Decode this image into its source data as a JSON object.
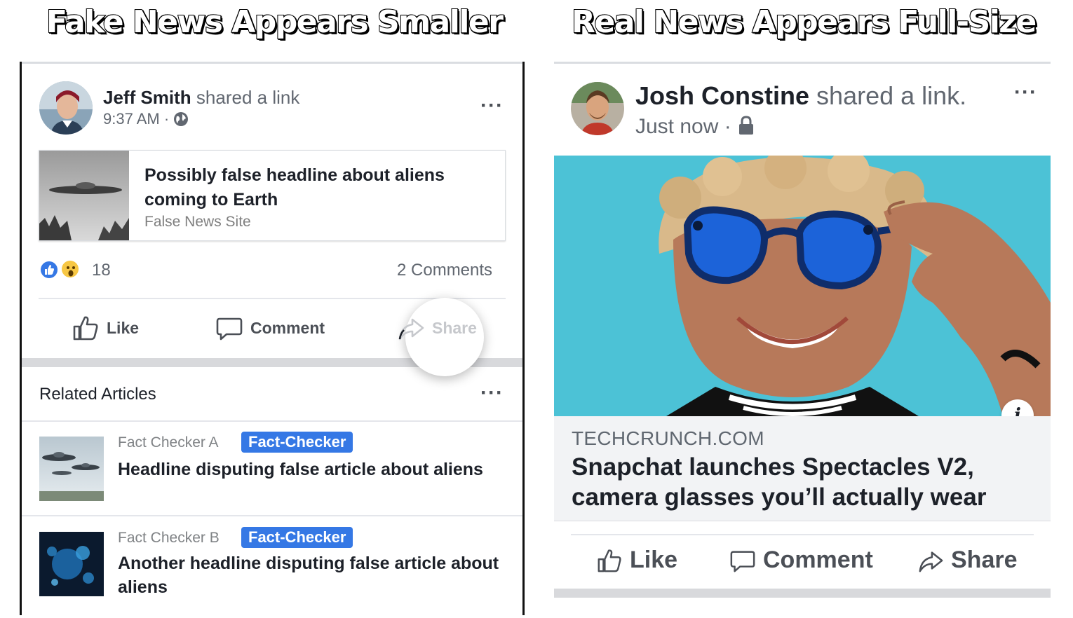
{
  "left_panel": {
    "banner": "Fake News Appears Smaller",
    "post": {
      "author": "Jeff Smith",
      "action": "shared a link",
      "time": "9:37 AM",
      "link": {
        "title": "Possibly false headline about aliens coming to Earth",
        "source": "False News Site"
      },
      "reaction_count": "18",
      "comments": "2 Comments",
      "like_label": "Like",
      "comment_label": "Comment",
      "share_label": "Share"
    },
    "related": {
      "title": "Related Articles",
      "items": [
        {
          "checker": "Fact Checker A",
          "badge": "Fact-Checker",
          "headline": "Headline disputing false article about aliens"
        },
        {
          "checker": "Fact Checker B",
          "badge": "Fact-Checker",
          "headline": "Another headline disputing false article about aliens"
        }
      ]
    }
  },
  "right_panel": {
    "banner": "Real News Appears Full-Size",
    "post": {
      "author": "Josh Constine",
      "action": "shared a link.",
      "time": "Just now",
      "source": "TECHCRUNCH.COM",
      "headline": "Snapchat launches Spectacles V2, camera glasses you’ll actually wear",
      "info": "i",
      "like_label": "Like",
      "comment_label": "Comment",
      "share_label": "Share"
    }
  },
  "colors": {
    "facebook_blue": "#3578e5",
    "text": "#1d2129",
    "muted": "#616770"
  },
  "icons": [
    "globe-icon",
    "lock-icon",
    "more-icon",
    "like-icon",
    "comment-icon",
    "share-icon",
    "like-reaction-icon",
    "wow-reaction-icon",
    "info-icon"
  ]
}
